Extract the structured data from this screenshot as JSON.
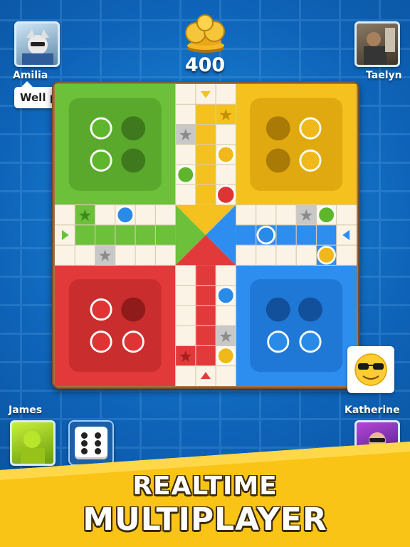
{
  "players": {
    "top_left": {
      "name": "Amilia",
      "chat": "Well played!"
    },
    "top_right": {
      "name": "Taelyn"
    },
    "bottom_left": {
      "name": "James"
    },
    "bottom_right": {
      "name": "Katherine"
    }
  },
  "coins": {
    "amount": "400",
    "icon": "gold-coin-stack-icon"
  },
  "dice": {
    "face": 6,
    "icon": "dice-icon"
  },
  "emote": {
    "icon": "sunglasses-emoji-icon"
  },
  "banner": {
    "line1": "REALTIME",
    "line2": "MULTIPLAYER"
  },
  "colors": {
    "green": "#6cc03a",
    "yellow": "#f4c11e",
    "red": "#e23a3a",
    "blue": "#2d8ef0",
    "board_wood": "#a87442"
  }
}
